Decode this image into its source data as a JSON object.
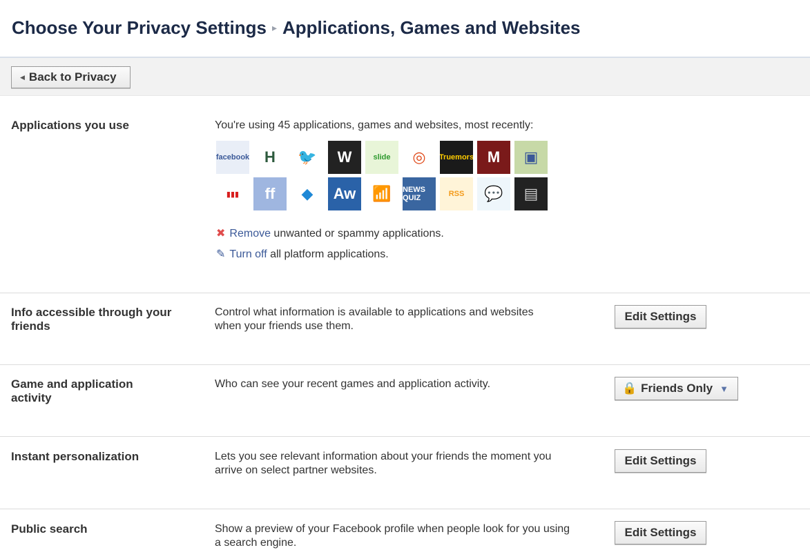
{
  "header": {
    "crumb1": "Choose Your Privacy Settings",
    "separator": "▸",
    "crumb2": "Applications, Games and Websites"
  },
  "toolbar": {
    "back_label": "Back to Privacy"
  },
  "apps_section": {
    "label": "Applications you use",
    "summary": "You're using 45 applications, games and websites, most recently:",
    "icons_row1": [
      {
        "name": "facebook-app-icon",
        "text": "facebook",
        "bg": "#e9eef7",
        "fg": "#3b5998"
      },
      {
        "name": "h-app-icon",
        "text": "H",
        "bg": "#ffffff",
        "fg": "#2d5a3d"
      },
      {
        "name": "twitter-bird-icon",
        "text": "🐦",
        "bg": "#ffffff",
        "fg": "#39a9e0"
      },
      {
        "name": "wordpress-icon",
        "text": "W",
        "bg": "#222222",
        "fg": "#ffffff"
      },
      {
        "name": "slide-icon",
        "text": "slide",
        "bg": "#e8f5d8",
        "fg": "#2f9a2f"
      },
      {
        "name": "swirl-app-icon",
        "text": "◎",
        "bg": "#ffffff",
        "fg": "#e04a1a"
      },
      {
        "name": "trueburn-icon",
        "text": "Truemors",
        "bg": "#1a1a1a",
        "fg": "#ffcc00"
      },
      {
        "name": "m-app-icon",
        "text": "M",
        "bg": "#7a1a1a",
        "fg": "#ffffff"
      },
      {
        "name": "photo-app-icon",
        "text": "▣",
        "bg": "#c7d9a7",
        "fg": "#3b5998"
      }
    ],
    "icons_row2": [
      {
        "name": "bars-app-icon",
        "text": "▮▮▮",
        "bg": "#ffffff",
        "fg": "#d81e1e"
      },
      {
        "name": "ff-app-icon",
        "text": "ff",
        "bg": "#9fb6e0",
        "fg": "#ffffff"
      },
      {
        "name": "diamond-app-icon",
        "text": "◆",
        "bg": "#ffffff",
        "fg": "#1e88d6"
      },
      {
        "name": "aw-app-icon",
        "text": "Aw",
        "bg": "#2a62a8",
        "fg": "#ffffff"
      },
      {
        "name": "wifi-app-icon",
        "text": "📶",
        "bg": "#ffffff",
        "fg": "#f28a1a"
      },
      {
        "name": "news-quiz-icon",
        "text": "NEWS QUIZ",
        "bg": "#3a66a0",
        "fg": "#ffffff"
      },
      {
        "name": "rss-reader-icon",
        "text": "RSS",
        "bg": "#fff4d8",
        "fg": "#f39a1a"
      },
      {
        "name": "chat-bubble-icon",
        "text": "💬",
        "bg": "#eef6fb",
        "fg": "#3ba9e0"
      },
      {
        "name": "phone-app-icon",
        "text": "▤",
        "bg": "#222222",
        "fg": "#cccccc"
      }
    ],
    "remove_link": "Remove",
    "remove_rest": " unwanted or spammy applications.",
    "turnoff_link": "Turn off",
    "turnoff_rest": " all platform applications."
  },
  "rows": [
    {
      "label": "Info accessible through your friends",
      "desc": "Control what information is available to applications and websites when your friends use them.",
      "button": "Edit Settings"
    },
    {
      "label": "Game and application activity",
      "desc": "Who can see your recent games and application activity.",
      "button": "Friends Only"
    },
    {
      "label": "Instant personalization",
      "desc": "Lets you see relevant information about your friends the moment you arrive on select partner websites.",
      "button": "Edit Settings"
    },
    {
      "label": "Public search",
      "desc": "Show a preview of your Facebook profile when people look for you using a search engine.",
      "button": "Edit Settings"
    }
  ]
}
